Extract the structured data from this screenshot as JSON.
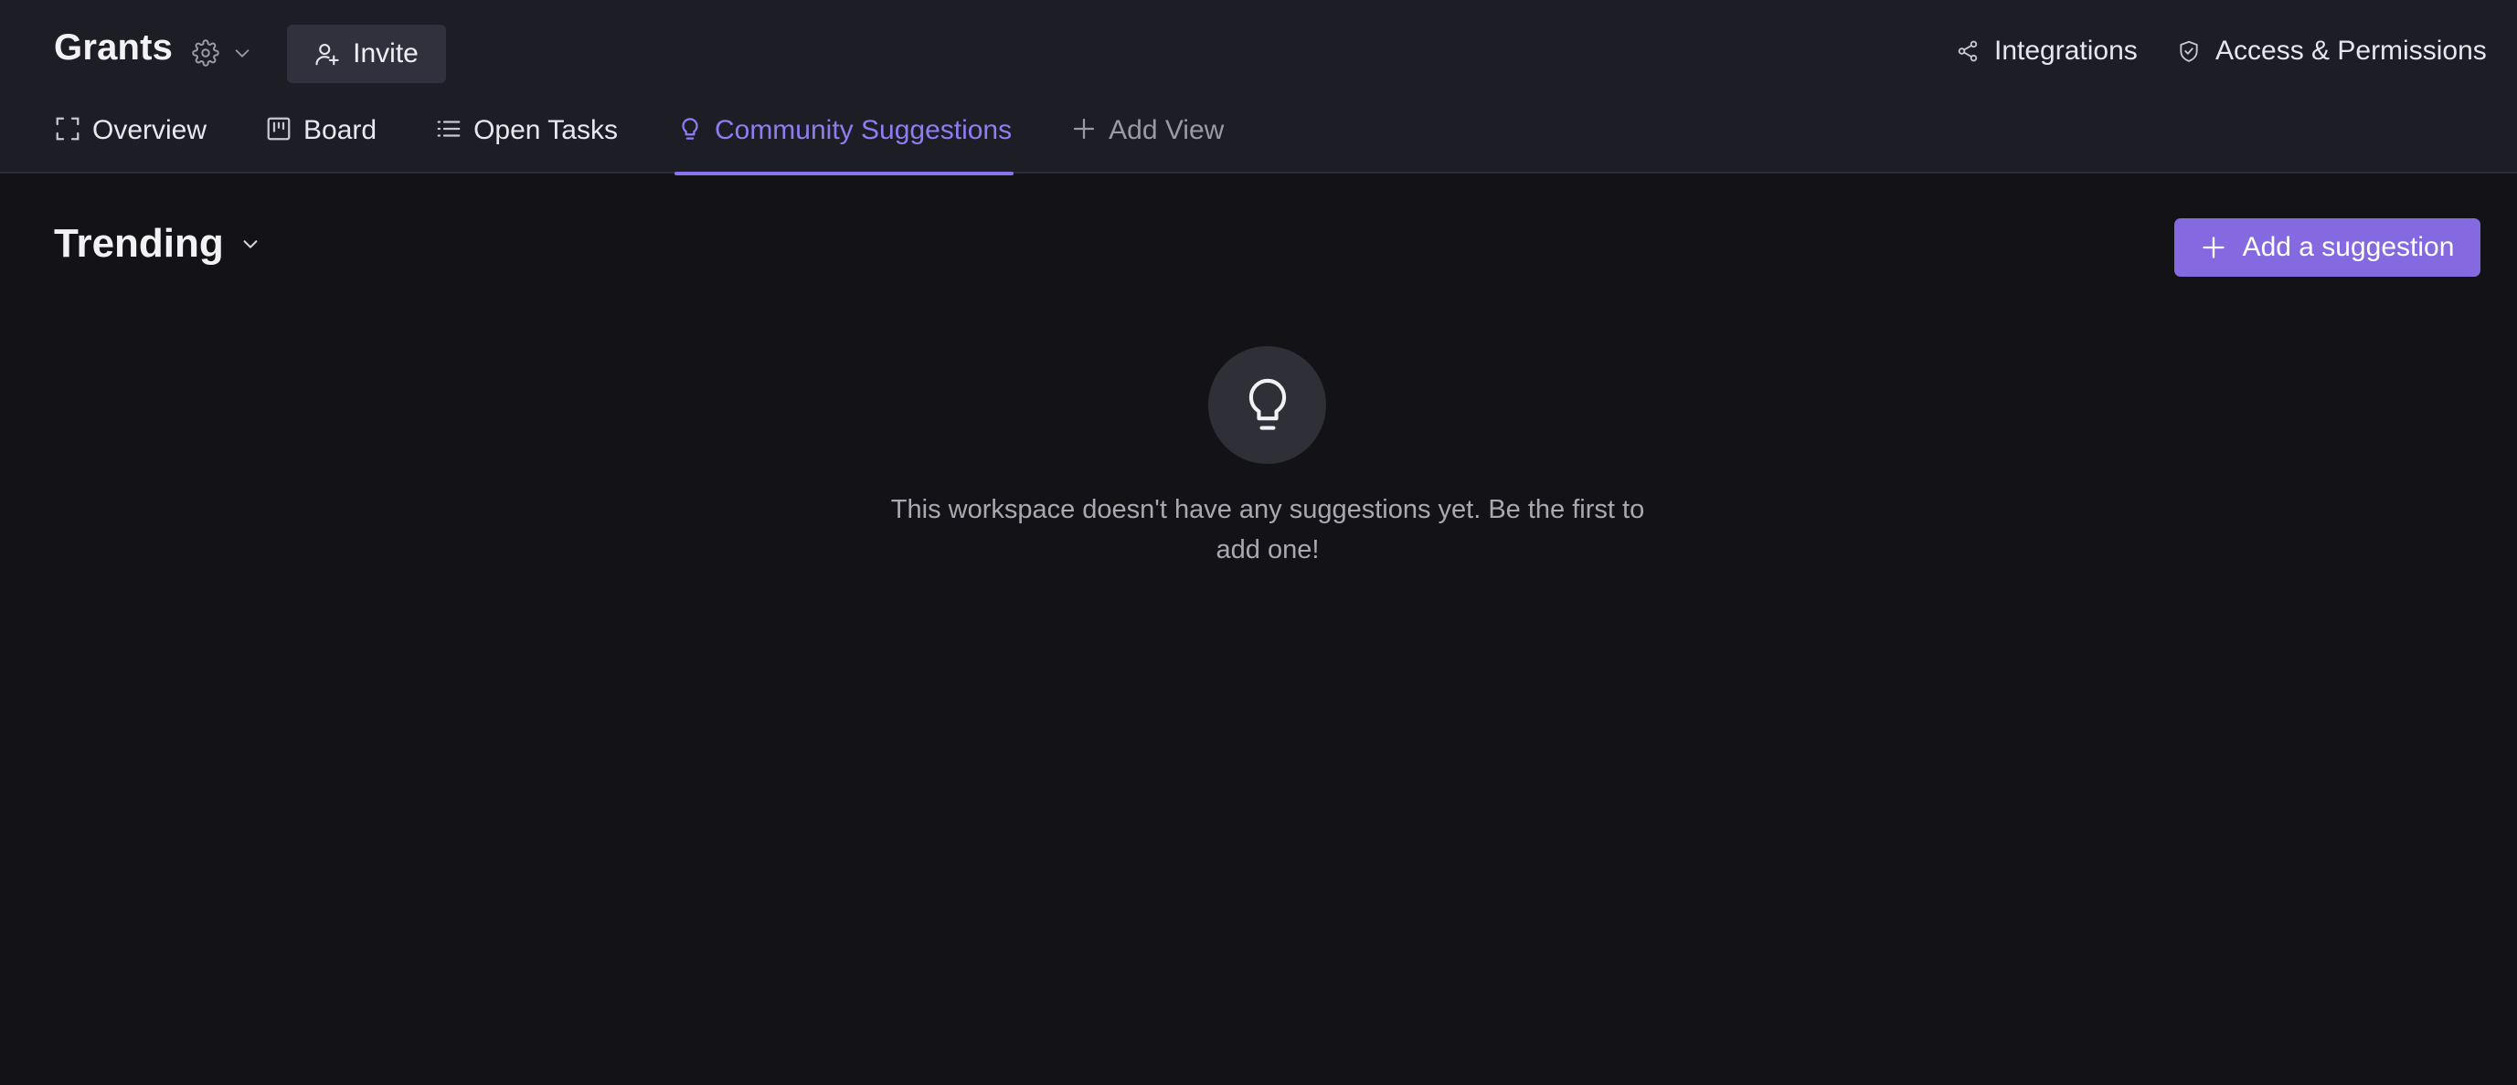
{
  "workspace": {
    "title": "Grants",
    "settings_icon": "gear-icon",
    "settings_caret_icon": "chevron-down-icon",
    "invite_label": "Invite",
    "invite_icon": "add-user-icon"
  },
  "top_links": {
    "integrations": {
      "label": "Integrations",
      "icon": "share-nodes-icon"
    },
    "access": {
      "label": "Access & Permissions",
      "icon": "shield-check-icon"
    }
  },
  "tabs": [
    {
      "label": "Overview",
      "icon": "frame-corners-icon",
      "active": false
    },
    {
      "label": "Board",
      "icon": "kanban-board-icon",
      "active": false
    },
    {
      "label": "Open Tasks",
      "icon": "list-icon",
      "active": false
    },
    {
      "label": "Community Suggestions",
      "icon": "lightbulb-icon",
      "active": true
    },
    {
      "label": "Add View",
      "icon": "plus-icon",
      "active": false
    }
  ],
  "content": {
    "sort_label": "Trending",
    "sort_caret_icon": "chevron-down-icon",
    "add_button_label": "Add a suggestion",
    "add_button_icon": "plus-icon",
    "empty_icon": "lightbulb-icon",
    "empty_message": "This workspace doesn't have any suggestions yet. Be the first to add one!"
  },
  "colors": {
    "accent": "#8569e0",
    "active_tab": "#8f7cf1",
    "header_bg": "#1d1d26",
    "page_bg": "#131317"
  }
}
